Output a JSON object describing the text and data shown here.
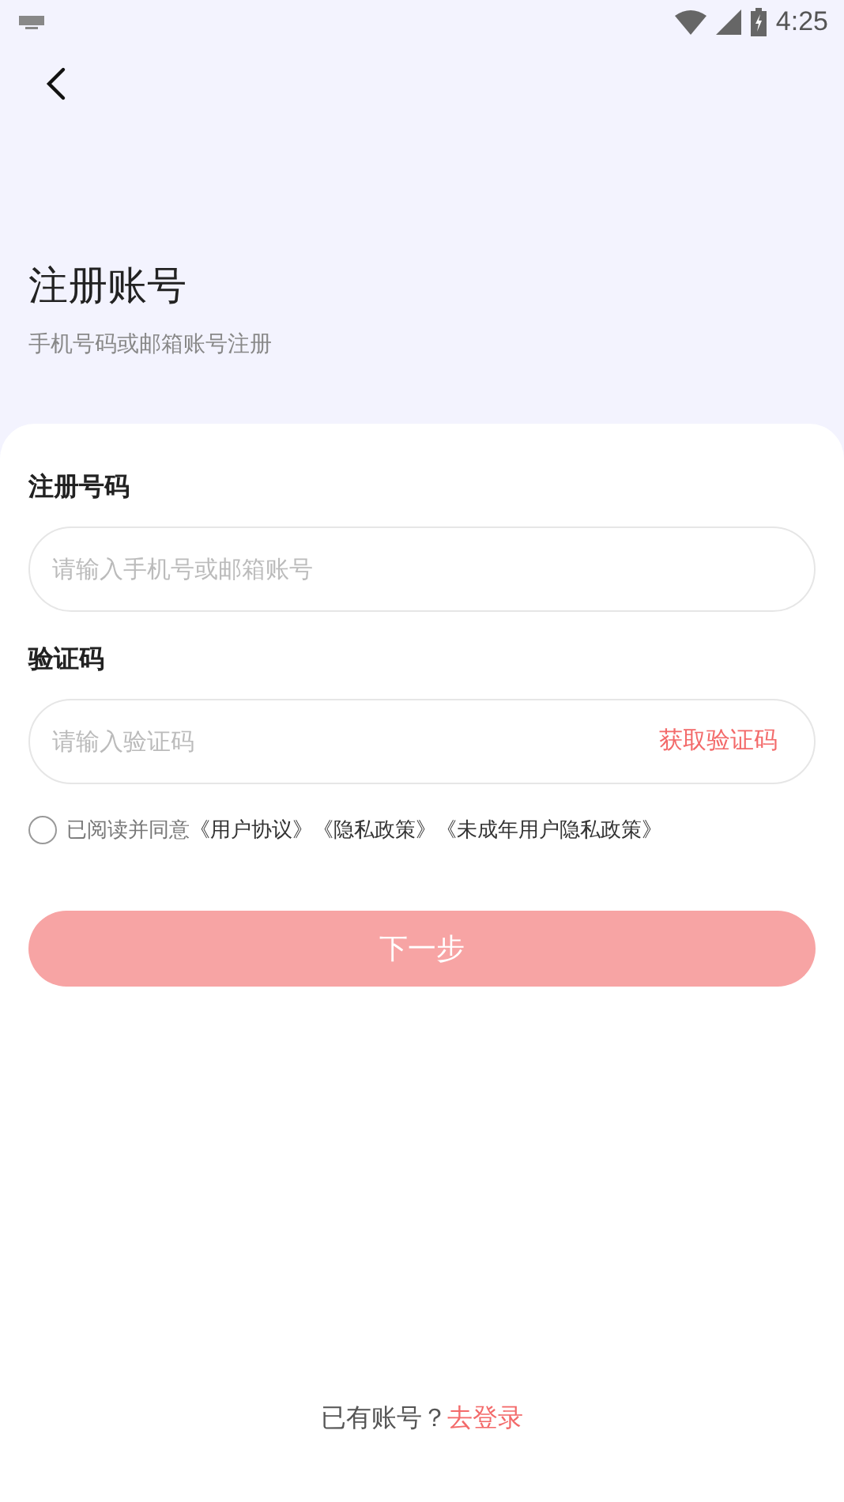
{
  "status_bar": {
    "time": "4:25"
  },
  "header": {
    "title": "注册账号",
    "subtitle": "手机号码或邮箱账号注册"
  },
  "form": {
    "fields": [
      {
        "label": "注册号码",
        "placeholder": "请输入手机号或邮箱账号"
      },
      {
        "label": "验证码",
        "placeholder": "请输入验证码",
        "action": "获取验证码"
      }
    ],
    "agreement": {
      "checked": false,
      "prefix": "已阅读并同意",
      "links": [
        "《用户协议》",
        "《隐私政策》",
        "《未成年用户隐私政策》"
      ]
    },
    "submit": {
      "label": "下一步",
      "disabled": true
    }
  },
  "footer": {
    "text": "已有账号？",
    "link": "去登录"
  }
}
